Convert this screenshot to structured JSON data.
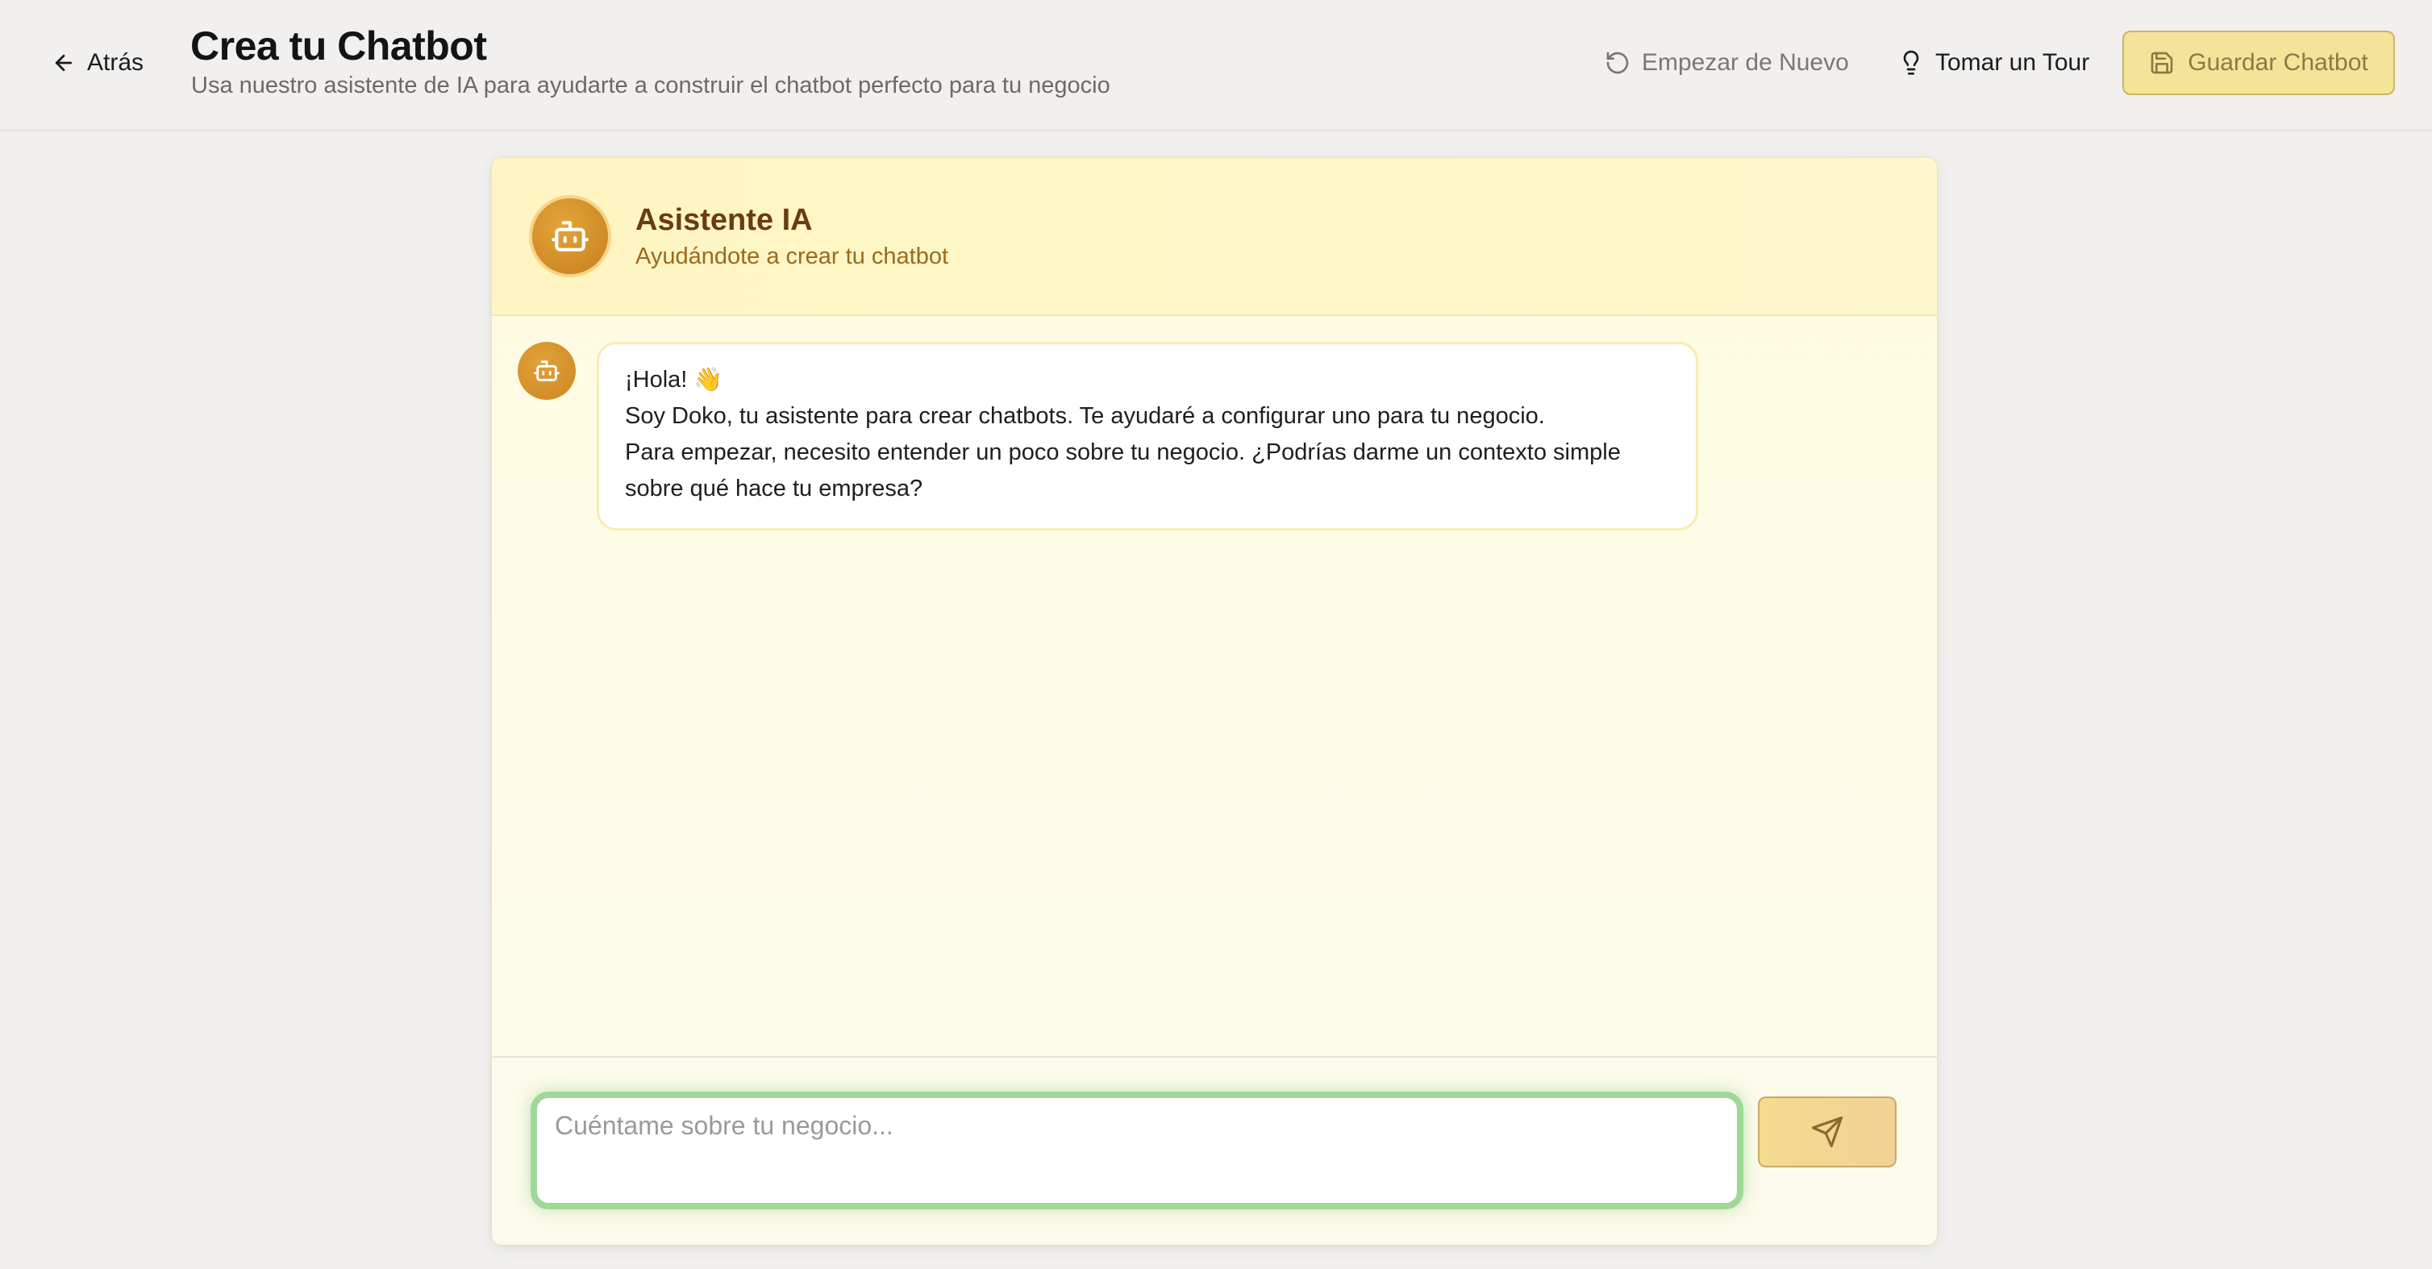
{
  "header": {
    "back_label": "Atrás",
    "title": "Crea tu Chatbot",
    "subtitle": "Usa nuestro asistente de IA para ayudarte a construir el chatbot perfecto para tu negocio",
    "restart_label": "Empezar de Nuevo",
    "tour_label": "Tomar un Tour",
    "save_label": "Guardar Chatbot"
  },
  "chat": {
    "assistant_name": "Asistente IA",
    "assistant_desc": "Ayudándote a crear tu chatbot",
    "messages": [
      {
        "lines": [
          "¡Hola! 👋",
          "Soy Doko, tu asistente para crear chatbots. Te ayudaré a configurar uno para tu negocio.",
          "Para empezar, necesito entender un poco sobre tu negocio. ¿Podrías darme un contexto simple sobre qué hace tu empresa?"
        ]
      }
    ],
    "input_placeholder": "Cuéntame sobre tu negocio..."
  },
  "icons": {
    "back": "arrow-left-icon",
    "restart": "rotate-ccw-icon",
    "tour": "lightbulb-icon",
    "save": "save-icon",
    "assistant": "bot-icon",
    "send": "send-icon"
  },
  "colors": {
    "accent": "#d4922b",
    "save_button_bg": "#f3e49a",
    "input_focus": "#9fd898",
    "header_bg": "#fff5c2"
  }
}
